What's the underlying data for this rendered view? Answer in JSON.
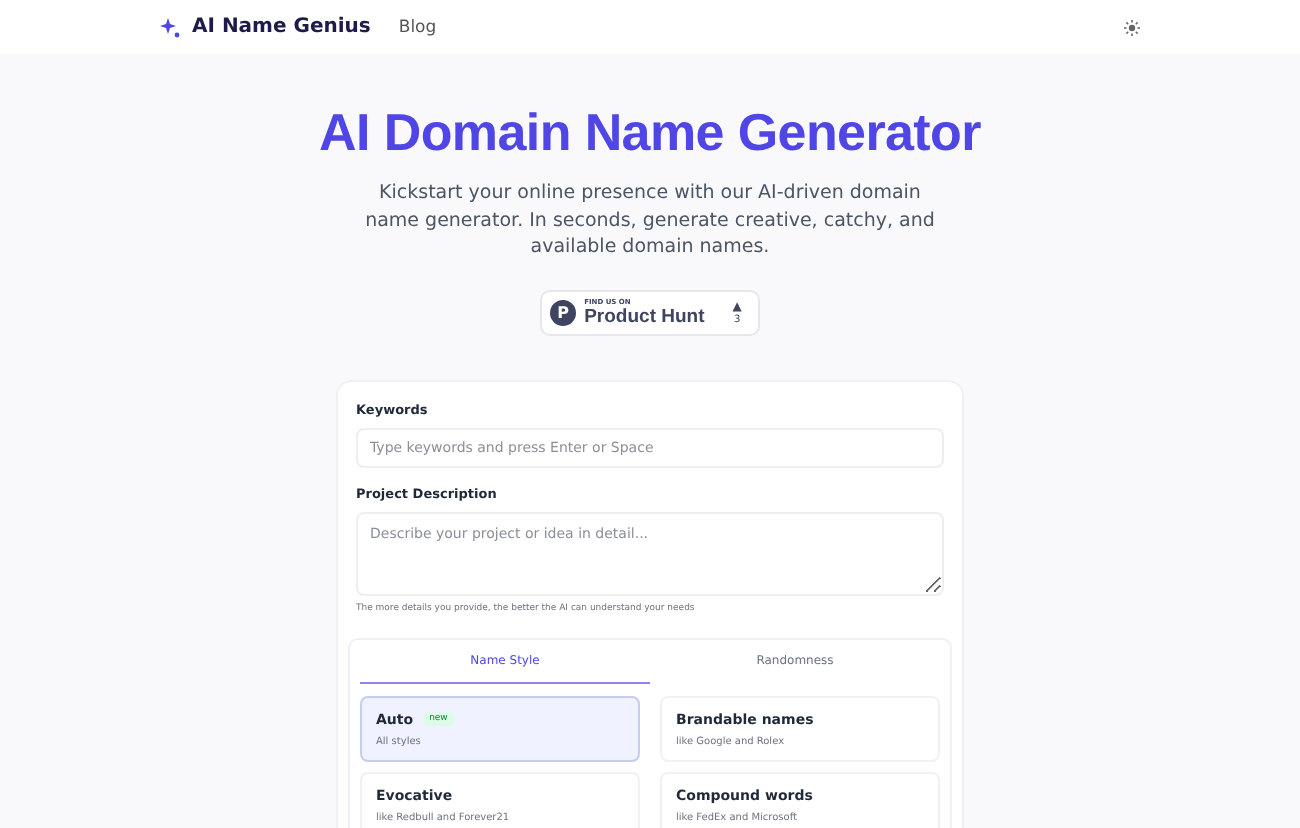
{
  "header": {
    "brand": "AI Name Genius",
    "nav": [
      {
        "label": "Blog"
      }
    ]
  },
  "hero": {
    "title": "AI Domain Name Generator",
    "subtitle": "Kickstart your online presence with our AI-driven domain name generator. In seconds, generate creative, catchy, and available domain names."
  },
  "badge": {
    "letter": "P",
    "caption": "FIND US ON",
    "name": "Product Hunt",
    "arrow": "▲",
    "count": "3"
  },
  "form": {
    "keywords": {
      "label": "Keywords",
      "placeholder": "Type keywords and press Enter or Space"
    },
    "description": {
      "label": "Project Description",
      "placeholder": "Describe your project or idea in detail...",
      "hint": "The more details you provide, the better the AI can understand your needs"
    },
    "tabs": [
      {
        "label": "Name Style",
        "selected": true
      },
      {
        "label": "Randomness",
        "selected": false
      }
    ],
    "styles": [
      {
        "title": "Auto",
        "tag": "new",
        "subtitle": "All styles",
        "selected": true
      },
      {
        "title": "Brandable names",
        "subtitle": "like Google and Rolex",
        "selected": false
      },
      {
        "title": "Evocative",
        "subtitle": "like Redbull and Forever21",
        "selected": false
      },
      {
        "title": "Compound words",
        "subtitle": "like FedEx and Microsoft",
        "selected": false
      }
    ]
  }
}
